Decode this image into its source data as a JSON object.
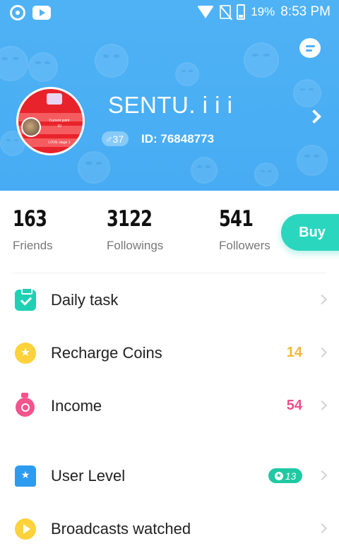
{
  "status_bar": {
    "battery": "19%",
    "time": "8:53 PM",
    "icons": [
      "chrome-icon",
      "youtube-icon",
      "wifi-icon",
      "no-sim-icon",
      "battery-icon"
    ]
  },
  "profile": {
    "username": "SENTU. i i i",
    "gender_age": "♂37",
    "user_id": "ID: 76848773",
    "avatar_lines": [
      "Current point",
      "10",
      "LOVE stage 1"
    ]
  },
  "stats": [
    {
      "value": "163",
      "label": "Friends"
    },
    {
      "value": "3122",
      "label": "Followings"
    },
    {
      "value": "541",
      "label": "Followers"
    }
  ],
  "buy_label": "Buy",
  "menu": [
    {
      "label": "Daily task",
      "value": "",
      "icon": "clipboard-check-icon"
    },
    {
      "label": "Recharge Coins",
      "value": "14",
      "value_color": "#f1b93a",
      "icon": "coin-icon"
    },
    {
      "label": "Income",
      "value": "54",
      "value_color": "#f04d8c",
      "icon": "money-bag-icon"
    },
    {
      "label": "User Level",
      "value": "",
      "badge": "13",
      "badge_color": "#1fc9a3",
      "icon": "level-shield-icon"
    },
    {
      "label": "Broadcasts watched",
      "value": "",
      "icon": "play-icon"
    }
  ],
  "colors": {
    "header": "#4fb2f5",
    "accent": "#2bd6be"
  }
}
